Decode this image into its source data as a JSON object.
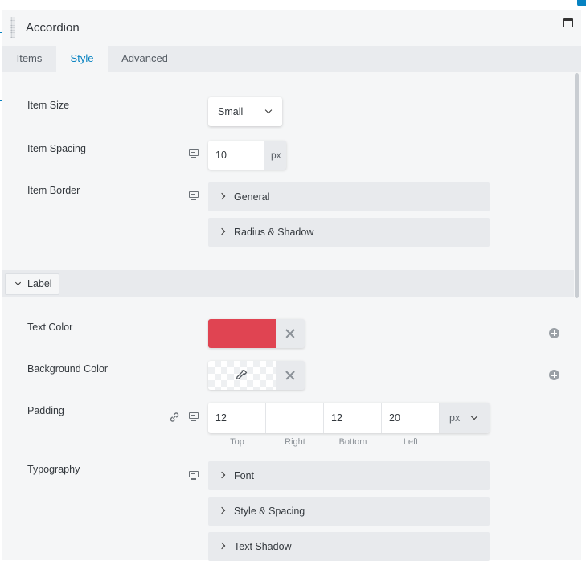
{
  "panel": {
    "title": "Accordion",
    "tabs": [
      {
        "label": "Items"
      },
      {
        "label": "Style"
      },
      {
        "label": "Advanced"
      }
    ],
    "active_tab": "Style"
  },
  "items_section": {
    "item_size": {
      "label": "Item Size",
      "value": "Small"
    },
    "item_spacing": {
      "label": "Item Spacing",
      "value": "10",
      "unit": "px"
    },
    "item_border": {
      "label": "Item Border",
      "groups": [
        "General",
        "Radius & Shadow"
      ]
    }
  },
  "label_section": {
    "title": "Label",
    "text_color": {
      "label": "Text Color",
      "value": "#e04452"
    },
    "background_color": {
      "label": "Background Color",
      "value": ""
    },
    "padding": {
      "label": "Padding",
      "top": "12",
      "right": "",
      "bottom": "12",
      "left": "20",
      "unit": "px",
      "sub_labels": [
        "Top",
        "Right",
        "Bottom",
        "Left"
      ]
    },
    "typography": {
      "label": "Typography",
      "groups": [
        "Font",
        "Style & Spacing",
        "Text Shadow"
      ]
    }
  },
  "icons": {
    "responsive": "monitor-icon",
    "link": "link-icon",
    "clear": "close-icon",
    "picker": "eyedropper-icon",
    "add": "plus-circle-icon"
  },
  "colors": {
    "accent": "#0782c1",
    "panel_bg": "#f5f6f7",
    "field_bg": "#e8eaed"
  }
}
